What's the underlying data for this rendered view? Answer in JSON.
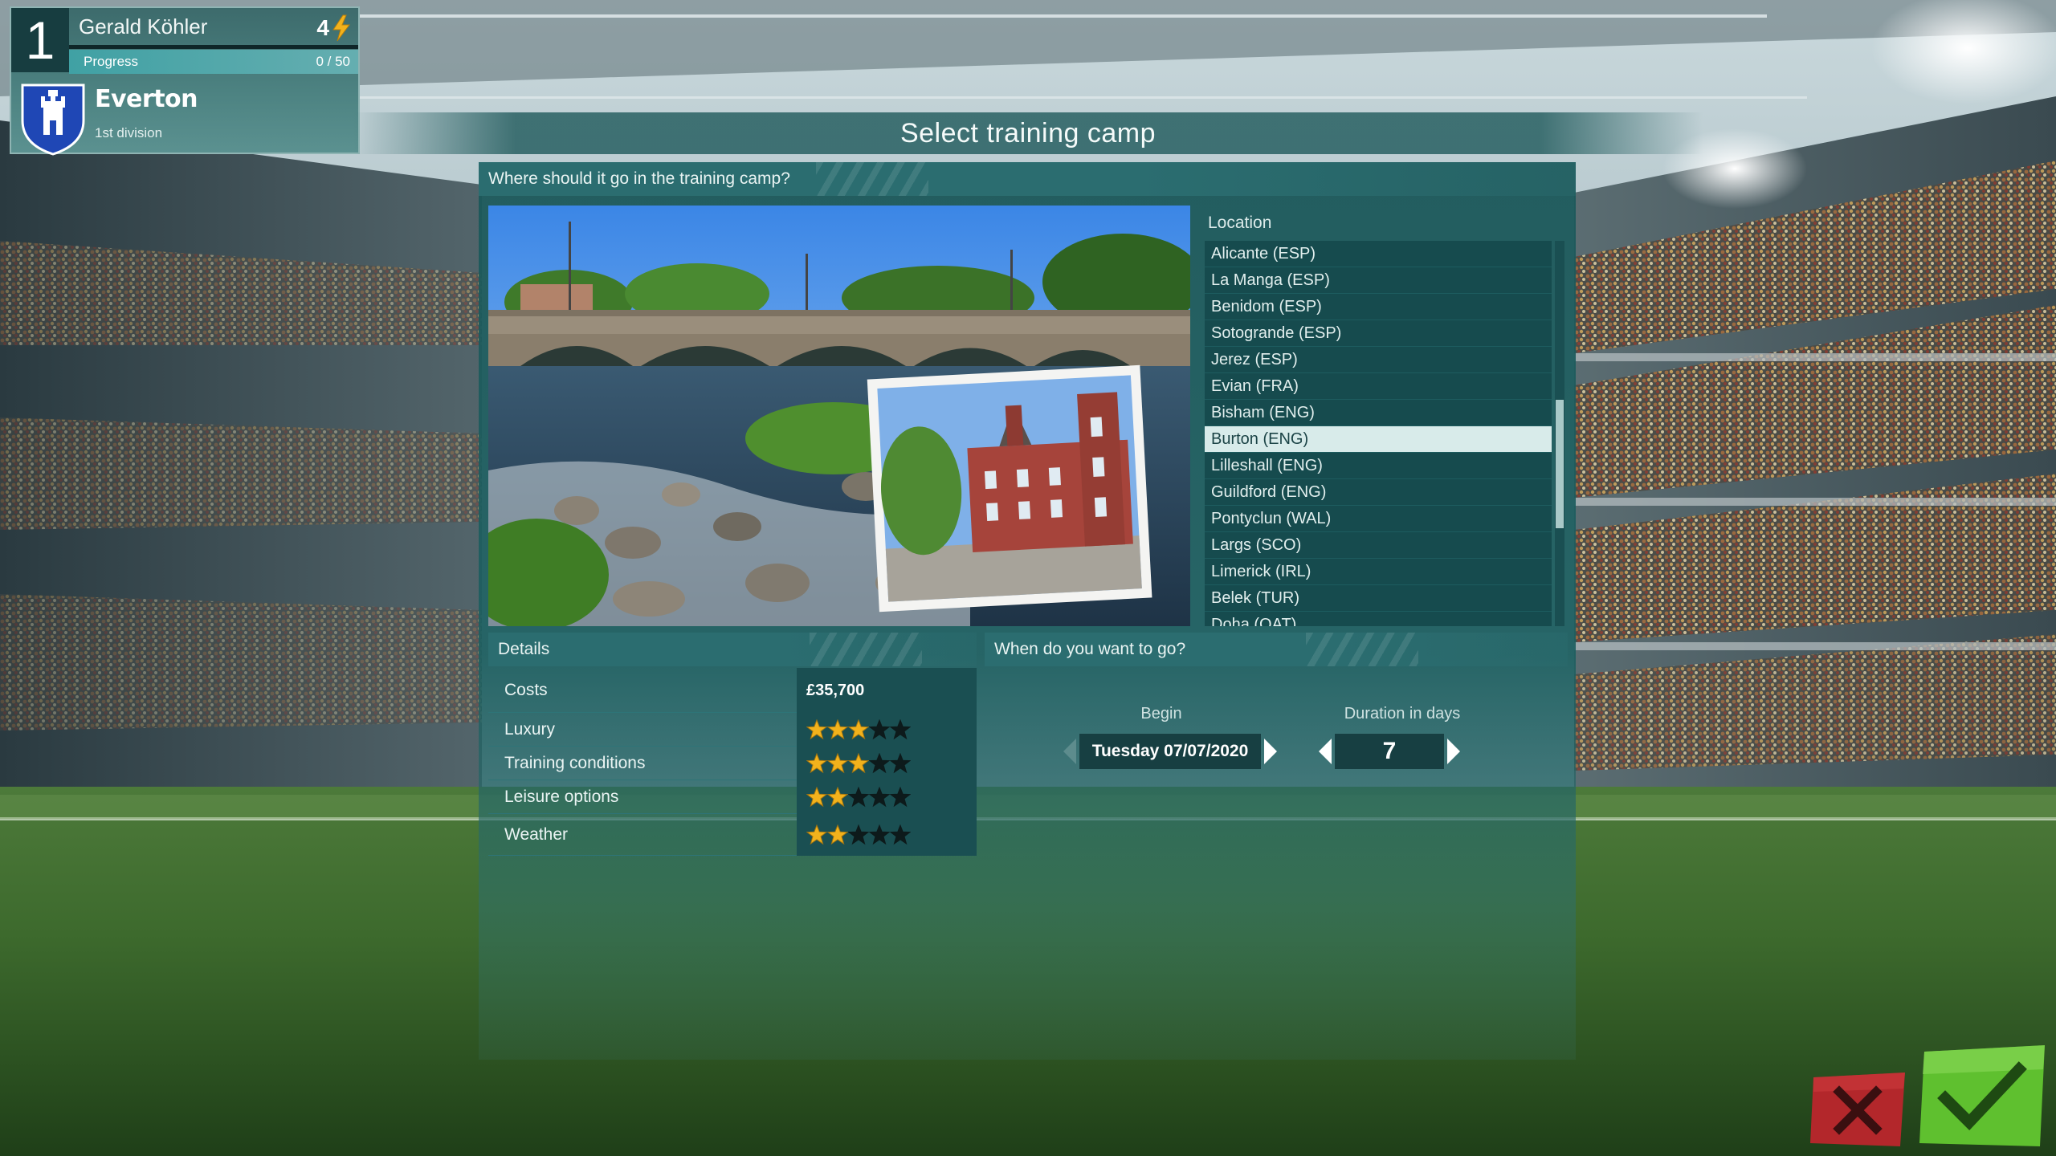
{
  "manager": {
    "rank": "1",
    "name": "Gerald Köhler",
    "points": "4",
    "progress_label": "Progress",
    "progress_text": "0 / 50",
    "progress_fraction": 0.0,
    "club_name": "Everton",
    "division": "1st division"
  },
  "page": {
    "title": "Select training camp"
  },
  "where": {
    "header": "Where should it go in the training camp?",
    "location_label": "Location",
    "locations": [
      "Alicante (ESP)",
      "La Manga (ESP)",
      "Benidom (ESP)",
      "Sotogrande (ESP)",
      "Jerez (ESP)",
      "Evian (FRA)",
      "Bisham (ENG)",
      "Burton (ENG)",
      "Lilleshall (ENG)",
      "Guildford (ENG)",
      "Pontyclun (WAL)",
      "Largs (SCO)",
      "Limerick (IRL)",
      "Belek (TUR)",
      "Doha (QAT)"
    ],
    "selected_index": 7
  },
  "details": {
    "header": "Details",
    "costs_label": "Costs",
    "costs_value": "£35,700",
    "ratings": [
      {
        "label": "Luxury",
        "stars": 3,
        "max": 5
      },
      {
        "label": "Training conditions",
        "stars": 3,
        "max": 5
      },
      {
        "label": "Leisure options",
        "stars": 2,
        "max": 5
      },
      {
        "label": "Weather",
        "stars": 2,
        "max": 5
      }
    ]
  },
  "when": {
    "header": "When do you want to go?",
    "begin_label": "Begin",
    "begin_value": "Tuesday 07/07/2020",
    "duration_label": "Duration in days",
    "duration_value": "7"
  },
  "colors": {
    "panel": "#1f5f61",
    "accent_gold": "#f2b21c",
    "confirm_green": "#5cc22f",
    "cancel_red": "#b7262a"
  },
  "icons": {
    "points": "lightning-bolt-icon",
    "crest": "castle-crest-icon",
    "prev": "triangle-left-icon",
    "next": "triangle-right-icon",
    "cancel": "x-icon",
    "confirm": "checkmark-icon"
  }
}
